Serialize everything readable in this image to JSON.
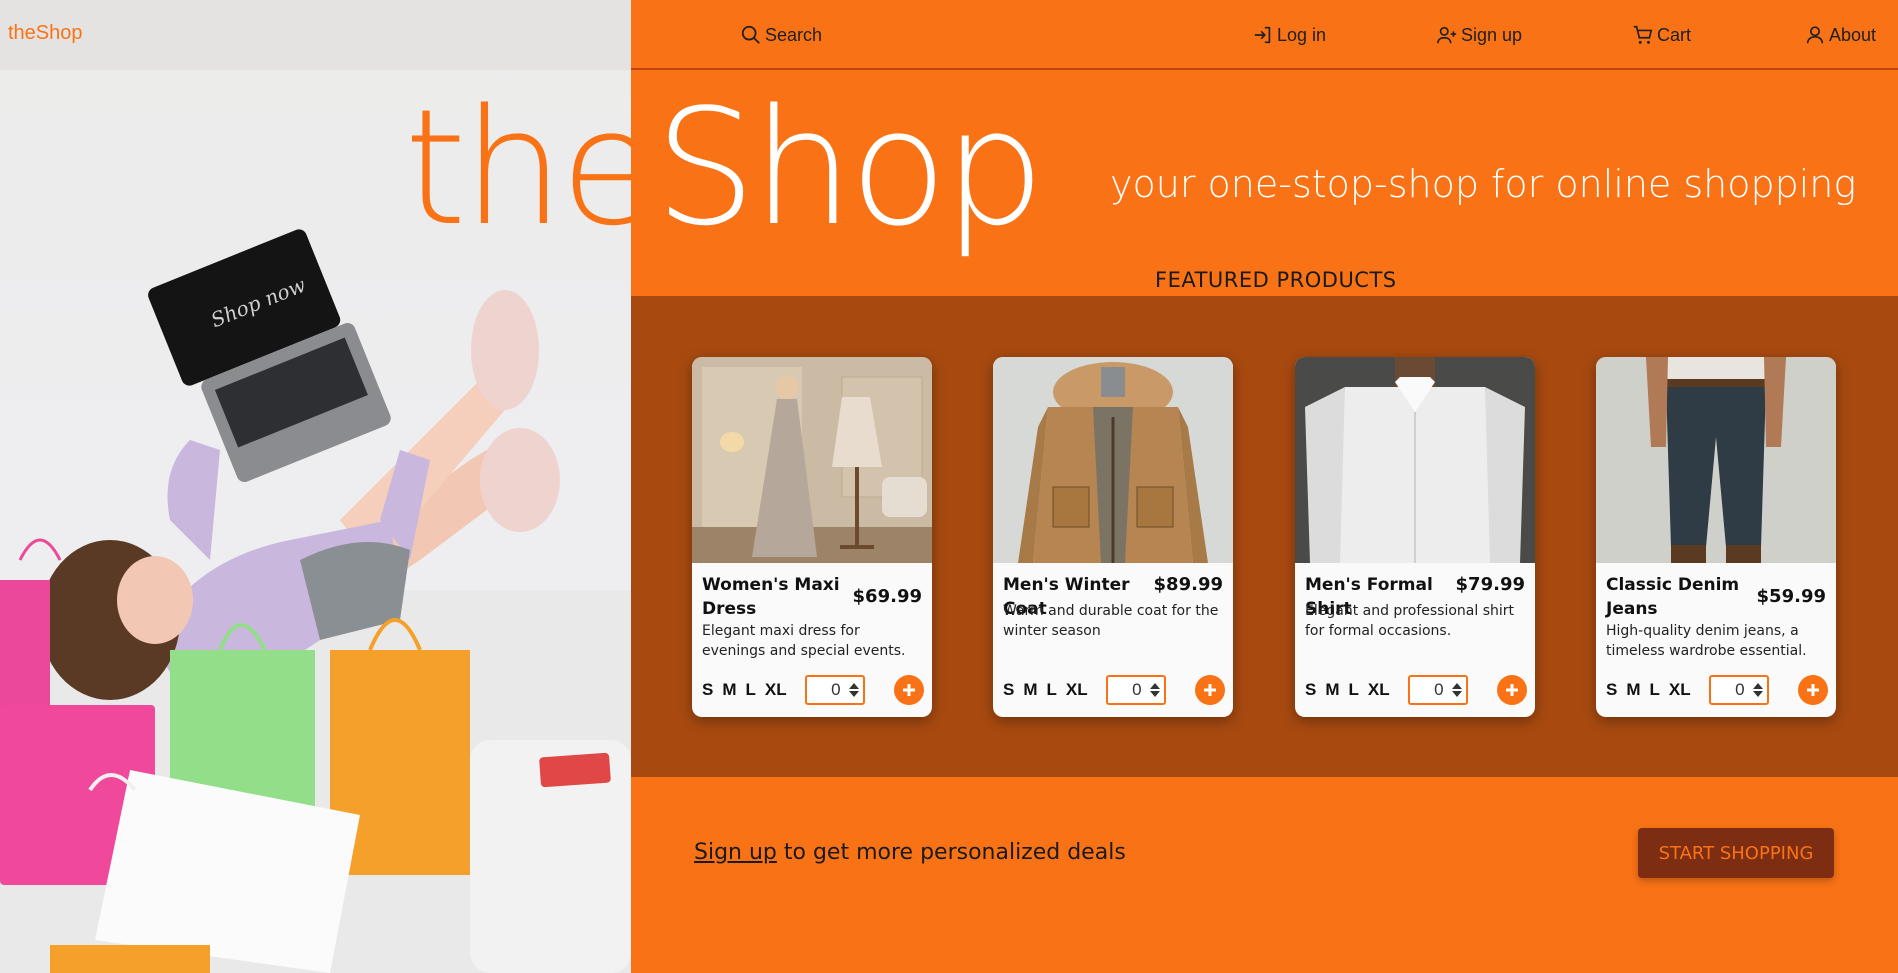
{
  "brand": {
    "logo_text": "theShop",
    "accent_color": "#f97316",
    "dark_accent_color": "#a84a10"
  },
  "nav": {
    "search": {
      "label": "Search",
      "icon": "search-icon"
    },
    "login": {
      "label": "Log in",
      "icon": "login-icon"
    },
    "signup": {
      "label": "Sign up",
      "icon": "user-plus-icon"
    },
    "cart": {
      "label": "Cart",
      "icon": "cart-icon"
    },
    "about": {
      "label": "About",
      "icon": "user-icon"
    }
  },
  "hero": {
    "title_part1": "the",
    "title_part2": "Shop",
    "tagline": "your one-stop-shop for online shopping",
    "laptop_text": "Shop now"
  },
  "featured": {
    "heading": "FEATURED PRODUCTS",
    "products": [
      {
        "name": "Women's Maxi Dress",
        "price": "$69.99",
        "description": "Elegant maxi dress for evenings and special events.",
        "sizes": [
          "S",
          "M",
          "L",
          "XL"
        ],
        "quantity": "0"
      },
      {
        "name": "Men's Winter Coat",
        "price": "$89.99",
        "description": "Warm and durable coat for the winter season",
        "sizes": [
          "S",
          "M",
          "L",
          "XL"
        ],
        "quantity": "0"
      },
      {
        "name": "Men's Formal Shirt",
        "price": "$79.99",
        "description": "Elegant and professional shirt for formal occasions.",
        "sizes": [
          "S",
          "M",
          "L",
          "XL"
        ],
        "quantity": "0"
      },
      {
        "name": "Classic Denim Jeans",
        "price": "$59.99",
        "description": "High-quality denim jeans, a timeless wardrobe essential.",
        "sizes": [
          "S",
          "M",
          "L",
          "XL"
        ],
        "quantity": "0"
      }
    ]
  },
  "cta": {
    "signup_link": "Sign up",
    "signup_text": " to get more personalized deals",
    "start_button": "START SHOPPING"
  }
}
